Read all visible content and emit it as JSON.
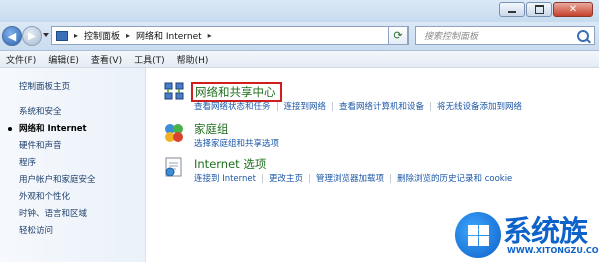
{
  "window": {
    "address": {
      "crumbs": [
        "控制面板",
        "网络和 Internet"
      ]
    },
    "search_placeholder": "搜索控制面板"
  },
  "menu": [
    "文件(F)",
    "编辑(E)",
    "查看(V)",
    "工具(T)",
    "帮助(H)"
  ],
  "sidebar": {
    "items": [
      {
        "label": "控制面板主页",
        "active": false
      },
      {
        "label": "系统和安全",
        "active": false
      },
      {
        "label": "网络和 Internet",
        "active": true
      },
      {
        "label": "硬件和声音",
        "active": false
      },
      {
        "label": "程序",
        "active": false
      },
      {
        "label": "用户帐户和家庭安全",
        "active": false
      },
      {
        "label": "外观和个性化",
        "active": false
      },
      {
        "label": "时钟、语言和区域",
        "active": false
      },
      {
        "label": "轻松访问",
        "active": false
      }
    ]
  },
  "categories": [
    {
      "title": "网络和共享中心",
      "icon": "network-sharing-icon",
      "highlighted": true,
      "links": [
        "查看网络状态和任务",
        "连接到网络",
        "查看网络计算机和设备",
        "将无线设备添加到网络"
      ]
    },
    {
      "title": "家庭组",
      "icon": "homegroup-icon",
      "highlighted": false,
      "links": [
        "选择家庭组和共享选项"
      ]
    },
    {
      "title": "Internet 选项",
      "icon": "internet-options-icon",
      "highlighted": false,
      "links": [
        "连接到 Internet",
        "更改主页",
        "管理浏览器加载项",
        "删除浏览的历史记录和 cookie"
      ]
    }
  ],
  "watermark": {
    "brand": "系统族",
    "url": "WWW.XITONGZU.COM"
  },
  "colors": {
    "link": "#1b57a8",
    "category_title": "#1f6e1f",
    "highlight_box": "#d21d1d",
    "brand": "#0d63c9"
  }
}
